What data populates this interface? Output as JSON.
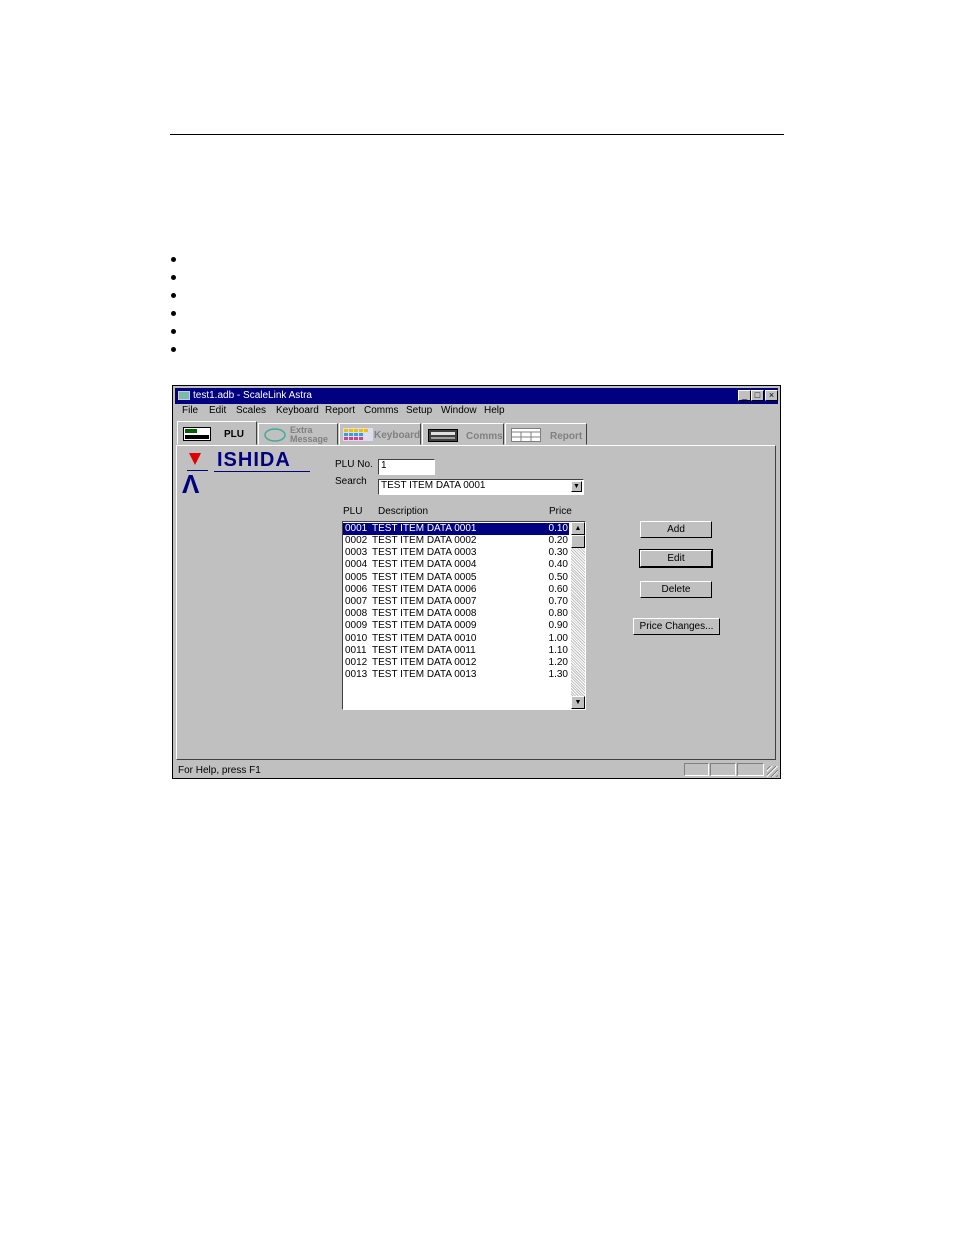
{
  "window": {
    "title": "test1.adb - ScaleLink Astra",
    "min": "_",
    "max": "□",
    "close": "×"
  },
  "menu": [
    "File",
    "Edit",
    "Scales",
    "Keyboard",
    "Report",
    "Comms",
    "Setup",
    "Window",
    "Help"
  ],
  "tabs": [
    {
      "label": "PLU",
      "active": true
    },
    {
      "label": "Extra Message",
      "active": false
    },
    {
      "label": "Keyboard",
      "active": false
    },
    {
      "label": "Comms",
      "active": false
    },
    {
      "label": "Report",
      "active": false
    }
  ],
  "logo": {
    "wordmark": "ISHIDA",
    "mark": "Λ"
  },
  "form": {
    "plu_no_label": "PLU No.",
    "plu_no_value": "1",
    "search_label": "Search",
    "search_value": "TEST ITEM DATA 0001"
  },
  "list": {
    "headers": {
      "plu": "PLU",
      "description": "Description",
      "price": "Price"
    },
    "rows": [
      {
        "plu": "0001",
        "description": "TEST ITEM DATA 0001",
        "price": "0.10",
        "selected": true
      },
      {
        "plu": "0002",
        "description": "TEST ITEM DATA 0002",
        "price": "0.20"
      },
      {
        "plu": "0003",
        "description": "TEST ITEM DATA 0003",
        "price": "0.30"
      },
      {
        "plu": "0004",
        "description": "TEST ITEM DATA 0004",
        "price": "0.40"
      },
      {
        "plu": "0005",
        "description": "TEST ITEM DATA 0005",
        "price": "0.50"
      },
      {
        "plu": "0006",
        "description": "TEST ITEM DATA 0006",
        "price": "0.60"
      },
      {
        "plu": "0007",
        "description": "TEST ITEM DATA 0007",
        "price": "0.70"
      },
      {
        "plu": "0008",
        "description": "TEST ITEM DATA 0008",
        "price": "0.80"
      },
      {
        "plu": "0009",
        "description": "TEST ITEM DATA 0009",
        "price": "0.90"
      },
      {
        "plu": "0010",
        "description": "TEST ITEM DATA 0010",
        "price": "1.00"
      },
      {
        "plu": "0011",
        "description": "TEST ITEM DATA 0011",
        "price": "1.10"
      },
      {
        "plu": "0012",
        "description": "TEST ITEM DATA 0012",
        "price": "1.20"
      },
      {
        "plu": "0013",
        "description": "TEST ITEM DATA 0013",
        "price": "1.30"
      }
    ]
  },
  "buttons": {
    "add": "Add",
    "edit": "Edit",
    "delete": "Delete",
    "price_changes": "Price Changes..."
  },
  "status": {
    "text": "For Help, press F1"
  },
  "colors": {
    "titlebar": "#000080",
    "selection": "#000080",
    "logo_red": "#e00000",
    "face": "#c0c0c0"
  }
}
